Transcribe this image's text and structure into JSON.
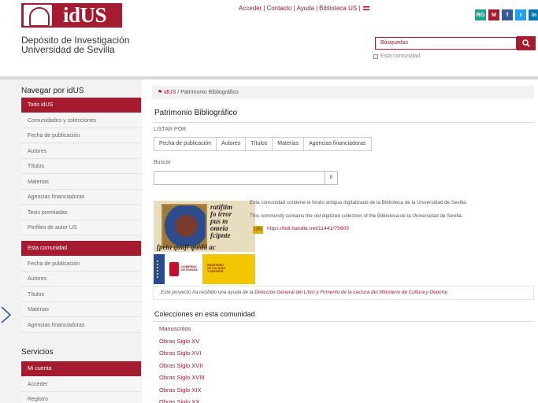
{
  "header": {
    "logo_text": "idUS",
    "title_line1": "Depósito de Investigación",
    "title_line2": "Universidad de Sevilla",
    "links": [
      "Acceder",
      "Contacto",
      "Ayuda",
      "Biblioteca US"
    ],
    "search_placeholder": "Búsquedas",
    "community_checkbox": "Esta comunidad",
    "social": [
      {
        "icon": "researchgate-icon",
        "glyph": "RG",
        "color": "#1fa58c"
      },
      {
        "icon": "mendeley-icon",
        "glyph": "M",
        "color": "#a51c30"
      },
      {
        "icon": "facebook-icon",
        "glyph": "f",
        "color": "#3b5998"
      },
      {
        "icon": "twitter-icon",
        "glyph": "t",
        "color": "#1da1f2"
      },
      {
        "icon": "linkedin-icon",
        "glyph": "in",
        "color": "#0077b5"
      }
    ],
    "accent": "#a51c30"
  },
  "sidebar": {
    "heading1": "Navegar por idUS",
    "items1": [
      {
        "label": "Todo idUS",
        "active": true
      },
      {
        "label": "Comunidades y colecciones",
        "active": false
      },
      {
        "label": "Fecha de publicación",
        "active": false
      },
      {
        "label": "Autores",
        "active": false
      },
      {
        "label": "Títulos",
        "active": false
      },
      {
        "label": "Materias",
        "active": false
      },
      {
        "label": "Agencias financiadoras",
        "active": false
      },
      {
        "label": "Tesis premiadas",
        "active": false
      },
      {
        "label": "Perfiles de autor US",
        "active": false
      }
    ],
    "items2": [
      {
        "label": "Esta comunidad",
        "active": true
      },
      {
        "label": "Fecha de publicación",
        "active": false
      },
      {
        "label": "Autores",
        "active": false
      },
      {
        "label": "Títulos",
        "active": false
      },
      {
        "label": "Materias",
        "active": false
      },
      {
        "label": "Agencias financiadoras",
        "active": false
      }
    ],
    "heading2": "Servicios",
    "items3": [
      {
        "label": "Mi cuenta",
        "active": true
      },
      {
        "label": "Acceder",
        "active": false
      },
      {
        "label": "Registro",
        "active": false
      }
    ]
  },
  "main": {
    "breadcrumb_root": "idUS",
    "breadcrumb_sep": "/",
    "breadcrumb_current": "Patrimonio Bibliográfico",
    "page_title": "Patrimonio Bibliográfico",
    "browse_label": "LISTAR POR",
    "browse_tabs": [
      "Fecha de publicación",
      "Autores",
      "Títulos",
      "Materias",
      "Agencias financiadoras"
    ],
    "search_label": "Buscar",
    "go_label": "Ir",
    "manuscript_lines": [
      "ratiftim",
      "fo irror",
      "pus m",
      "omeia",
      "fcipnte"
    ],
    "manuscript_bottom": "fpetu quafi quidā ac",
    "gov_logo": {
      "left": [
        "GOBIERNO",
        "DE ESPAÑA"
      ],
      "right": [
        "MINISTERIO",
        "DE CULTURA",
        "Y DEPORTE"
      ]
    },
    "desc_es": "Esta comunidad contiene el fondo antiguo digitalizado de la Biblioteca de la Universidad de Sevilla.",
    "desc_en": "This community contains the old digitized collection of the Biblioteca de la Universidad de Sevilla.",
    "uri_badge": "URI",
    "uri_link": "https://hdl.handle.net/11441/75605",
    "ack_prefix": "Este proyecto ha recibido una ayuda de la ",
    "ack_link": "Dirección General del Libro y Fomento de la Lectura del Ministerio de Cultura y Deporte",
    "ack_suffix": ".",
    "collections_heading": "Colecciones en esta comunidad",
    "collections": [
      "Manuscritos",
      "Obras Siglo XV",
      "Obras Siglo XVI",
      "Obras Siglo XVII",
      "Obras Siglo XVIII",
      "Obras Siglo XIX",
      "Obras Siglo XX"
    ]
  }
}
